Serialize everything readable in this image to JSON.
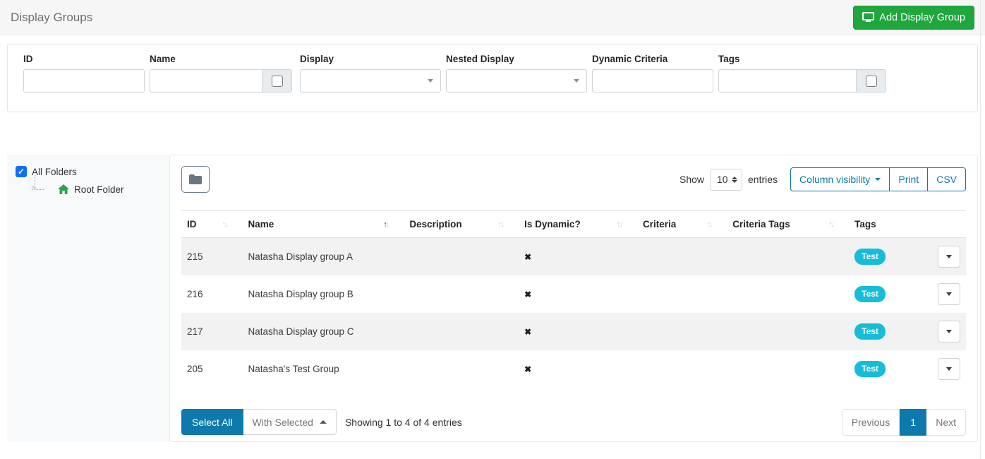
{
  "header": {
    "title": "Display Groups",
    "add_display_group_label": "Add Display Group"
  },
  "filters": {
    "id_label": "ID",
    "name_label": "Name",
    "display_label": "Display",
    "nested_display_label": "Nested Display",
    "dynamic_criteria_label": "Dynamic Criteria",
    "tags_label": "Tags",
    "id_value": "",
    "name_value": "",
    "display_value": "",
    "nested_display_value": "",
    "dynamic_criteria_value": "",
    "tags_value": ""
  },
  "folders": {
    "all_folders_label": "All Folders",
    "all_folders_checked": true,
    "root_folder_label": "Root Folder"
  },
  "controls": {
    "show_label": "Show",
    "page_size": "10",
    "entries_label": "entries",
    "column_visibility_label": "Column visibility",
    "print_label": "Print",
    "csv_label": "CSV"
  },
  "table": {
    "columns": {
      "id": "ID",
      "name": "Name",
      "description": "Description",
      "is_dynamic": "Is Dynamic?",
      "criteria": "Criteria",
      "criteria_tags": "Criteria Tags",
      "tags": "Tags"
    },
    "sorted_column": "Name",
    "sort_direction": "asc",
    "rows": [
      {
        "id": "215",
        "name": "Natasha Display group A",
        "description": "",
        "is_dynamic": false,
        "criteria": "",
        "criteria_tags": "",
        "tag": "Test"
      },
      {
        "id": "216",
        "name": "Natasha Display group B",
        "description": "",
        "is_dynamic": false,
        "criteria": "",
        "criteria_tags": "",
        "tag": "Test"
      },
      {
        "id": "217",
        "name": "Natasha Display group C",
        "description": "",
        "is_dynamic": false,
        "criteria": "",
        "criteria_tags": "",
        "tag": "Test"
      },
      {
        "id": "205",
        "name": "Natasha's Test Group",
        "description": "",
        "is_dynamic": false,
        "criteria": "",
        "criteria_tags": "",
        "tag": "Test"
      }
    ]
  },
  "footer": {
    "select_all_label": "Select All",
    "with_selected_label": "With Selected",
    "showing_text": "Showing 1 to 4 of 4 entries",
    "previous_label": "Previous",
    "current_page": "1",
    "next_label": "Next"
  },
  "icons": {
    "cross": "✖",
    "sort_up": "↑",
    "sort_down": "↓",
    "checkmark": "✓",
    "expander": "▷"
  },
  "colors": {
    "accent_blue": "#0e79ad",
    "success_green": "#1fa63d",
    "badge_cyan": "#15bdd8",
    "checkbox_blue": "#0d6efd",
    "home_green": "#28a745"
  }
}
